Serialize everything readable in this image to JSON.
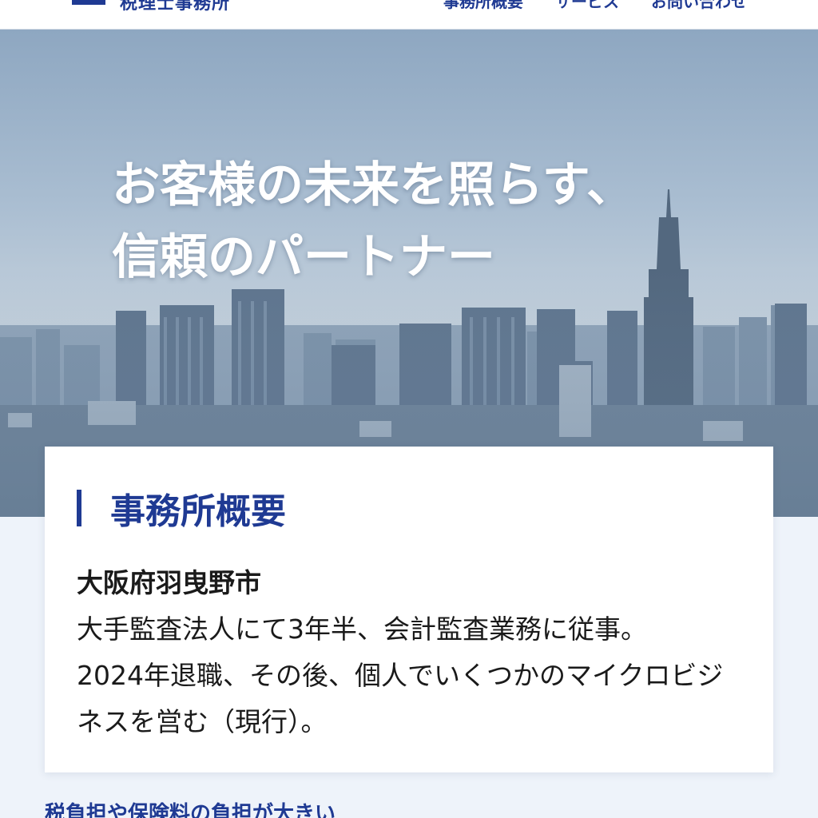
{
  "header": {
    "logo_text": "税理士事務所",
    "nav": [
      "事務所概要",
      "サービス",
      "お問い合わせ"
    ]
  },
  "hero": {
    "title_line1": "お客様の未来を照らす、",
    "title_line2": "信頼のパートナー"
  },
  "overview": {
    "title": "事務所概要",
    "location": "大阪府羽曳野市",
    "body_lines": [
      "大手監査法人にて3年半、会計監査業務に従事。",
      "2024年退職、その後、個人でいくつかのマイクロビジ",
      "ネスを営む（現行）。"
    ]
  },
  "next_section": {
    "heading": "税負担や保険料の負担が大きい"
  },
  "colors": {
    "brand": "#1f3a93",
    "background": "#eef3fa"
  }
}
